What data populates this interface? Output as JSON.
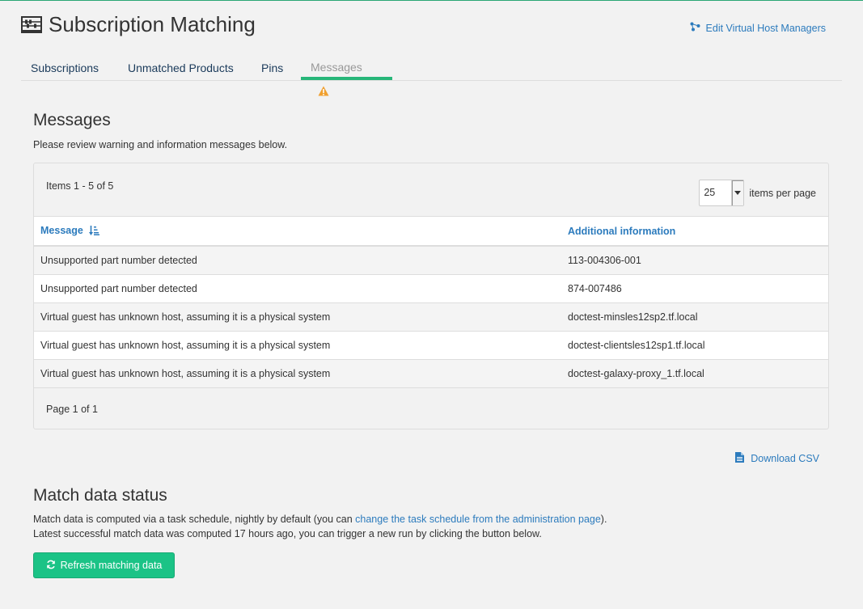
{
  "header": {
    "title": "Subscription Matching",
    "edit_vhm_label": "Edit Virtual Host Managers"
  },
  "tabs": [
    {
      "label": "Subscriptions"
    },
    {
      "label": "Unmatched Products"
    },
    {
      "label": "Pins"
    },
    {
      "label": "Messages"
    }
  ],
  "messages": {
    "heading": "Messages",
    "description": "Please review warning and information messages below.",
    "items_text": "Items 1 - 5 of 5",
    "per_page_value": "25",
    "per_page_label": "items per page",
    "columns": {
      "message": "Message",
      "info": "Additional information"
    },
    "rows": [
      {
        "message": "Unsupported part number detected",
        "info": "113-004306-001"
      },
      {
        "message": "Unsupported part number detected",
        "info": "874-007486"
      },
      {
        "message": "Virtual guest has unknown host, assuming it is a physical system",
        "info": "doctest-minsles12sp2.tf.local"
      },
      {
        "message": "Virtual guest has unknown host, assuming it is a physical system",
        "info": "doctest-clientsles12sp1.tf.local"
      },
      {
        "message": "Virtual guest has unknown host, assuming it is a physical system",
        "info": "doctest-galaxy-proxy_1.tf.local"
      }
    ],
    "page_text": "Page 1 of 1",
    "download_label": "Download CSV"
  },
  "status": {
    "heading": "Match data status",
    "line1_pre": "Match data is computed via a task schedule, nightly by default (you can ",
    "line1_link": "change the task schedule from the administration page",
    "line1_post": ").",
    "line2": "Latest successful match data was computed 17 hours ago, you can trigger a new run by clicking the button below.",
    "refresh_label": "Refresh matching data"
  },
  "colors": {
    "accent_green": "#1bc386",
    "link_blue": "#2c7bbd",
    "warning_orange": "#f0a030"
  }
}
